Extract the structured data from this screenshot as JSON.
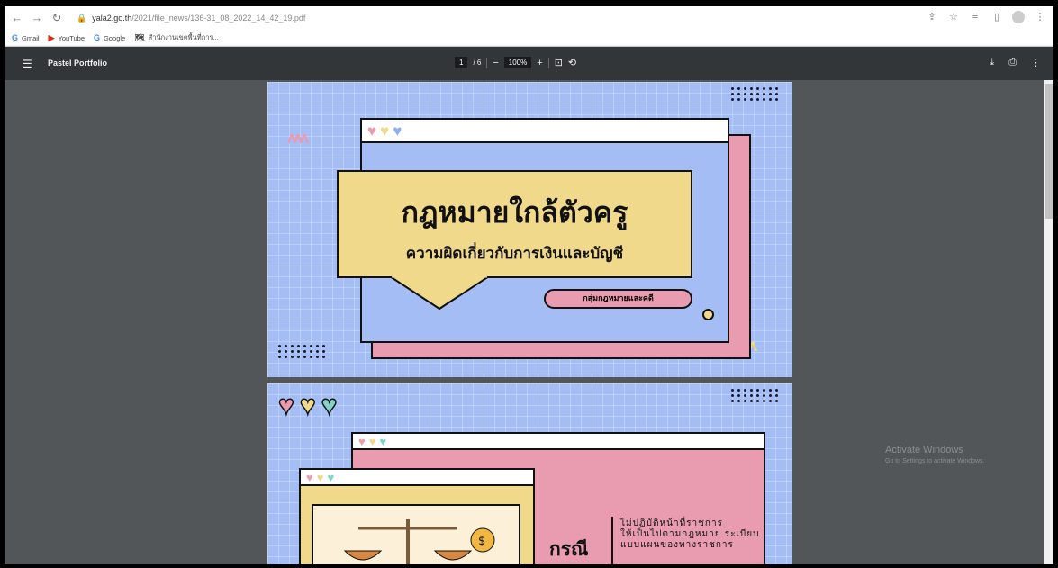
{
  "browser": {
    "url_host": "yala2.go.th",
    "url_path": "/2021/file_news/136-31_08_2022_14_42_19.pdf",
    "bookmarks": [
      {
        "label": "Gmail",
        "icon": "G"
      },
      {
        "label": "YouTube",
        "icon": "▶"
      },
      {
        "label": "Google",
        "icon": "G"
      },
      {
        "label": "สำนักงานเขตพื้นที่การ...",
        "icon": "🗺"
      }
    ]
  },
  "pdf_toolbar": {
    "title": "Pastel Portfolio",
    "page_current": "1",
    "page_total": "/ 6",
    "zoom": "100%"
  },
  "page1": {
    "main_title": "กฎหมายใกล้ตัวครู",
    "sub_title": "ความผิดเกี่ยวกับการเงินและบัญชี",
    "pill": "กลุ่มกฎหมายและคดี"
  },
  "page2": {
    "heading": "กรณี",
    "text_line1": "ไม่ปฏิบัติหน้าที่ราชการ",
    "text_line2": "ให้เป็นไปตามกฎหมาย ระเบียบ",
    "text_line3": "แบบแผนของทางราชการ"
  },
  "watermark": {
    "line1": "Activate Windows",
    "line2": "Go to Settings to activate Windows."
  },
  "colors": {
    "page_bg": "#a4bdf5",
    "pink": "#e99bb0",
    "yellow": "#f1d98b",
    "toolbar": "#323639",
    "viewer_bg": "#525659"
  }
}
